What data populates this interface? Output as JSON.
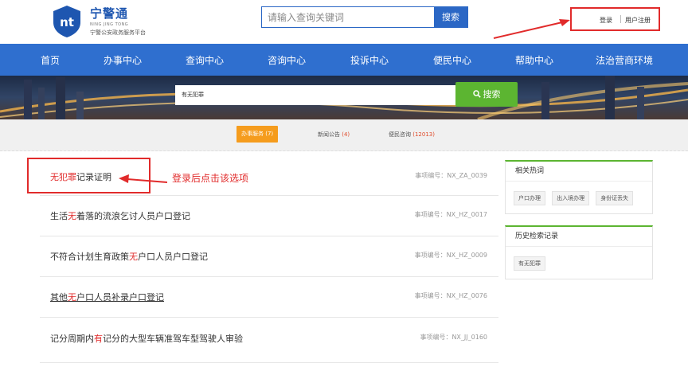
{
  "header": {
    "brand_name": "宁警通",
    "brand_en": "NING JING TONG",
    "brand_subtitle": "宁警公安政务服务平台",
    "search_placeholder": "请输入查询关键词",
    "search_button": "搜索",
    "login": "登录",
    "register": "用户注册"
  },
  "nav": {
    "items": [
      "首页",
      "办事中心",
      "查询中心",
      "咨询中心",
      "投诉中心",
      "便民中心",
      "帮助中心",
      "法治营商环境"
    ]
  },
  "banner": {
    "query": "有无犯罪",
    "search_button": "搜索"
  },
  "tabs": [
    {
      "label": "办事服务",
      "count": "(7)"
    },
    {
      "label": "新闻公告",
      "count": "(4)"
    },
    {
      "label": "便民咨询",
      "count": "(12013)"
    }
  ],
  "results": [
    {
      "title_highlight": "无犯罪",
      "title_rest": "记录证明",
      "code": "事项编号：NX_ZA_0039"
    },
    {
      "title_pre": "生活",
      "title_highlight": "无",
      "title_rest": "着落的流浪乞讨人员户口登记",
      "code": "事项编号：NX_HZ_0017"
    },
    {
      "title_pre": "不符合计划生育政策",
      "title_highlight": "无",
      "title_rest": "户口人员户口登记",
      "code": "事项编号：NX_HZ_0009"
    },
    {
      "title_pre": "其他",
      "title_highlight": "无",
      "title_rest": "户口人员补录户口登记",
      "code": "事项编号：NX_HZ_0076"
    },
    {
      "title_pre": "记分周期内",
      "title_highlight": "有",
      "title_rest": "记分的大型车辆准驾车型驾驶人审验",
      "code": "事项编号：NX_JJ_0160"
    }
  ],
  "annotation": "登录后点击该选项",
  "sidebar": {
    "hot_title": "相关热词",
    "hot_tags": [
      "户口办理",
      "出入境办理",
      "身份证丢失"
    ],
    "history_title": "历史检索记录",
    "history_tags": [
      "有无犯罪"
    ]
  },
  "colors": {
    "nav_blue": "#2f6fcf",
    "highlight_red": "#e12b2b",
    "green": "#5cb531",
    "orange": "#f59c1d"
  }
}
